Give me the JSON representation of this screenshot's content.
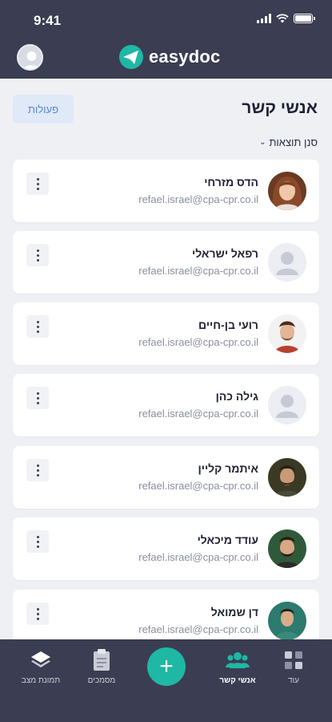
{
  "status": {
    "time": "9:41"
  },
  "header": {
    "app_name": "easydoc"
  },
  "page": {
    "title": "אנשי קשר",
    "actions_label": "פעולות",
    "filter_label": "סנן תוצאות"
  },
  "contacts": [
    {
      "name": "הדס מזרחי",
      "email": "refael.israel@cpa-cpr.co.il",
      "avatar": "photo-woman"
    },
    {
      "name": "רפאל ישראלי",
      "email": "refael.israel@cpa-cpr.co.il",
      "avatar": "placeholder"
    },
    {
      "name": "רועי בן-חיים",
      "email": "refael.israel@cpa-cpr.co.il",
      "avatar": "photo-man-1"
    },
    {
      "name": "גילה כהן",
      "email": "refael.israel@cpa-cpr.co.il",
      "avatar": "placeholder"
    },
    {
      "name": "איתמר קליין",
      "email": "refael.israel@cpa-cpr.co.il",
      "avatar": "photo-man-2"
    },
    {
      "name": "עודד מיכאלי",
      "email": "refael.israel@cpa-cpr.co.il",
      "avatar": "photo-man-3"
    },
    {
      "name": "דן שמואל",
      "email": "refael.israel@cpa-cpr.co.il",
      "avatar": "photo-man-4"
    }
  ],
  "tabbar": {
    "items": [
      {
        "label": "תמונת מצב",
        "icon": "layers-icon"
      },
      {
        "label": "מסמכים",
        "icon": "clipboard-icon"
      },
      {
        "label": "",
        "icon": "plus-icon"
      },
      {
        "label": "אנשי קשר",
        "icon": "people-icon"
      },
      {
        "label": "עוד",
        "icon": "grid-icon"
      }
    ],
    "active": "אנשי קשר",
    "fab_symbol": "+"
  },
  "colors": {
    "header_bg": "#3b3d52",
    "accent": "#1eb8a5",
    "actions_bg": "#dfe9f8",
    "actions_text": "#5b86cf"
  }
}
